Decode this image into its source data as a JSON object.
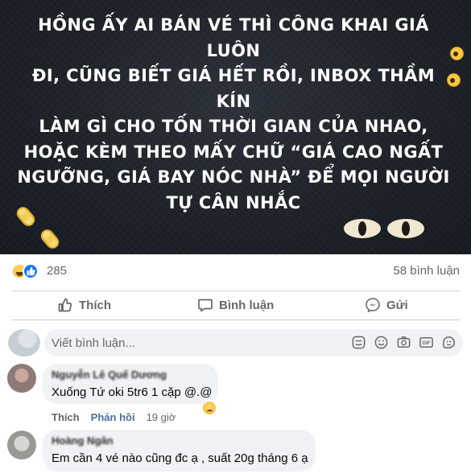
{
  "post": {
    "text": "HỒNG ẤY AI BÁN VÉ THÌ CÔNG KHAI GIÁ LUÔN ĐI, CŨNG BIẾT GIÁ HẾT RỒI, INBOX THẦM KÍN LÀM GÌ CHO TỐN THỜI GIAN CỦA NHAO, HOẶC KÈM THEO MẤY CHỮ “GIÁ CAO NGẤT NGƯỠNG, GIÁ BAY NÓC NHÀ” ĐỂ MỌI NGƯỜI TỰ CÂN NHẮC",
    "lines": [
      "HỒNG ẤY AI BÁN VÉ THÌ CÔNG KHAI GIÁ LUÔN",
      "ĐI, CŨNG BIẾT GIÁ HẾT RỒI, INBOX THẦM KÍN",
      "LÀM GÌ CHO TỐN THỜI GIAN CỦA NHAO,",
      "HOẶC KÈM THEO MẤY CHỮ “GIÁ CAO NGẤT",
      "NGƯỠNG, GIÁ BAY NÓC NHÀ” ĐỂ MỌI NGƯỜI",
      "TỰ CÂN NHẮC"
    ],
    "background_color": "#1e2229",
    "decor_icons": [
      "rolling-eyes-emoji-icon",
      "phone-icon",
      "cat-eyes-icon"
    ]
  },
  "reactions": {
    "icons": [
      "haha-icon",
      "like-icon"
    ],
    "count": "285",
    "comments_count": "58 bình luận"
  },
  "actions": {
    "like_label": "Thích",
    "comment_label": "Bình luận",
    "share_label": "Gửi"
  },
  "composer": {
    "placeholder": "Viết bình luận...",
    "tools": [
      "sticker-icon",
      "emoji-icon",
      "camera-icon",
      "gif-icon",
      "sticker-alt-icon"
    ]
  },
  "comments": [
    {
      "author": "Nguyễn Lê Quế Dương",
      "text": "Xuống Tứ oki 5tr6 1 cặp @.@",
      "reaction": "sad-icon",
      "like_label": "Thích",
      "reply_label": "Phản hồi",
      "time": "19 giờ"
    },
    {
      "author": "Hoàng Ngân",
      "text": "Em cần 4 vé nào cũng đc ạ , suất 20g tháng 6 ạ"
    }
  ],
  "colors": {
    "accent": "#1877f2",
    "secondary_text": "#65676b",
    "bubble": "#f0f2f5",
    "divider": "#ced0d4"
  }
}
